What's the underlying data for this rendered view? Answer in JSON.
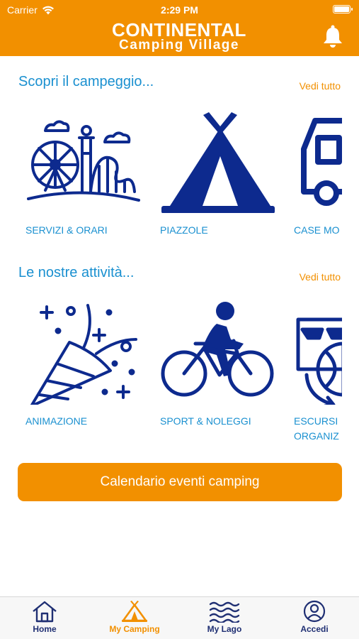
{
  "status": {
    "carrier": "Carrier",
    "time": "2:29 PM"
  },
  "header": {
    "logo_line1": "CONTINENTAL",
    "logo_line2": "Camping Village",
    "bell_icon": "bell-icon"
  },
  "colors": {
    "brand_orange": "#f29000",
    "brand_navy": "#0d2a8e",
    "link_blue": "#1a90d0"
  },
  "sections": [
    {
      "title": "Scopri il campeggio...",
      "see_all": "Vedi tutto",
      "tiles": [
        {
          "label": "SERVIZI & ORARI",
          "icon": "amusement-park-icon"
        },
        {
          "label": "PIAZZOLE",
          "icon": "tent-icon"
        },
        {
          "label": "CASE MO",
          "icon": "mobile-home-icon"
        }
      ]
    },
    {
      "title": "Le nostre attività...",
      "see_all": "Vedi tutto",
      "tiles": [
        {
          "label": "ANIMAZIONE",
          "icon": "party-popper-icon"
        },
        {
          "label": "SPORT & NOLEGGI",
          "icon": "cyclist-icon"
        },
        {
          "label": "ESCURSI\nORGANIZ",
          "icon": "excursion-globe-icon"
        }
      ]
    }
  ],
  "calendar_button": "Calendario eventi camping",
  "tabbar": {
    "active": "My Camping",
    "items": [
      {
        "label": "Home",
        "icon": "home-icon"
      },
      {
        "label": "My Camping",
        "icon": "tent-icon"
      },
      {
        "label": "My Lago",
        "icon": "waves-icon"
      },
      {
        "label": "Accedi",
        "icon": "user-icon"
      }
    ]
  }
}
